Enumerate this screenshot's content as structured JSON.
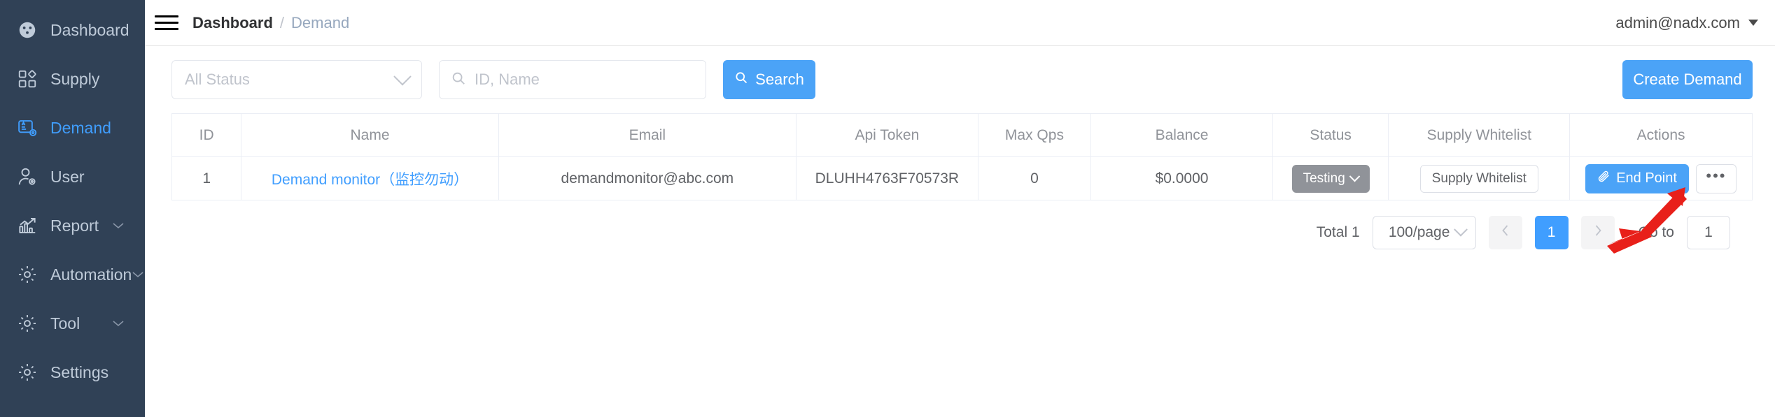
{
  "sidebar": {
    "items": [
      {
        "label": "Dashboard",
        "icon": "dashboard-icon",
        "active": false,
        "expandable": false
      },
      {
        "label": "Supply",
        "icon": "supply-icon",
        "active": false,
        "expandable": false
      },
      {
        "label": "Demand",
        "icon": "demand-icon",
        "active": true,
        "expandable": false
      },
      {
        "label": "User",
        "icon": "user-icon",
        "active": false,
        "expandable": false
      },
      {
        "label": "Report",
        "icon": "report-icon",
        "active": false,
        "expandable": true
      },
      {
        "label": "Automation",
        "icon": "gear-icon",
        "active": false,
        "expandable": true
      },
      {
        "label": "Tool",
        "icon": "gear-icon",
        "active": false,
        "expandable": true
      },
      {
        "label": "Settings",
        "icon": "gear-icon",
        "active": false,
        "expandable": false
      }
    ]
  },
  "topbar": {
    "menu_icon": "hamburger-icon",
    "breadcrumb_root": "Dashboard",
    "breadcrumb_separator": "/",
    "breadcrumb_current": "Demand",
    "user_email": "admin@nadx.com",
    "user_caret": "chevron-down-icon"
  },
  "toolbar": {
    "status_filter_value": "All Status",
    "search_placeholder": "ID, Name",
    "search_value": "",
    "search_icon": "search-icon",
    "search_button": "Search",
    "create_button": "Create Demand"
  },
  "table": {
    "columns": [
      "ID",
      "Name",
      "Email",
      "Api Token",
      "Max Qps",
      "Balance",
      "Status",
      "Supply Whitelist",
      "Actions"
    ],
    "rows": [
      {
        "id": "1",
        "name_en": "Demand monitor",
        "name_cn": "（监控勿动）",
        "email": "demandmonitor@abc.com",
        "api_token": "DLUHH4763F70573R",
        "max_qps": "0",
        "balance": "$0.0000",
        "status": "Testing",
        "whitelist_button": "Supply Whitelist",
        "endpoint_button": "End Point",
        "endpoint_icon": "link-paperclip-icon",
        "more_button": "•••"
      }
    ]
  },
  "pagination": {
    "total_label": "Total 1",
    "page_size": "100/page",
    "prev_icon": "chevron-left-icon",
    "next_icon": "chevron-right-icon",
    "current_page": "1",
    "goto_label": "Go to",
    "goto_value": "1"
  },
  "annotation": {
    "arrow_color": "#e8201a",
    "points_to": "End Point"
  },
  "colors": {
    "sidebar_bg": "#304156",
    "accent": "#409eff",
    "button_blue": "#4ba3f7",
    "status_gray": "#909399"
  }
}
